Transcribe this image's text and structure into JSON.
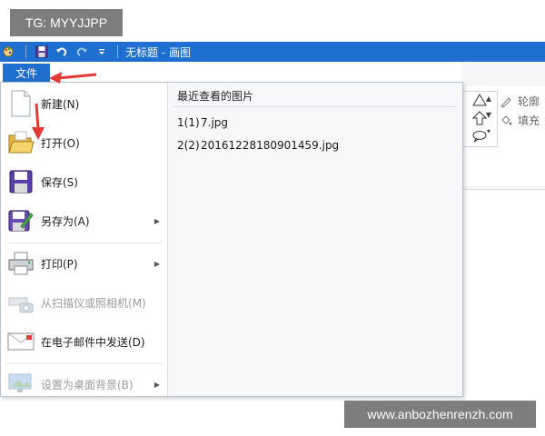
{
  "badge_text": "TG: MYYJJPP",
  "titlebar": {
    "title": "无标题 - 画图",
    "quick_access": [
      "paint-app-icon",
      "save-icon",
      "undo-icon",
      "redo-icon",
      "customize-dropdown-icon"
    ],
    "color": "#1f6fd0"
  },
  "file_tab": {
    "label": "文件"
  },
  "menu": {
    "items": [
      {
        "label": "新建(N)",
        "icon": "new-document-icon",
        "enabled": true,
        "submenu": false
      },
      {
        "label": "打开(O)",
        "icon": "open-folder-icon",
        "enabled": true,
        "submenu": false
      },
      {
        "label": "保存(S)",
        "icon": "save-disk-icon",
        "enabled": true,
        "submenu": false
      },
      {
        "label": "另存为(A)",
        "icon": "save-as-icon",
        "enabled": true,
        "submenu": true
      },
      {
        "label": "打印(P)",
        "icon": "printer-icon",
        "enabled": true,
        "submenu": true
      },
      {
        "label": "从扫描仪或照相机(M)",
        "icon": "scanner-camera-icon",
        "enabled": false,
        "submenu": false
      },
      {
        "label": "在电子邮件中发送(D)",
        "icon": "email-icon",
        "enabled": true,
        "submenu": false
      },
      {
        "label": "设置为桌面背景(B)",
        "icon": "desktop-background-icon",
        "enabled": false,
        "submenu": true
      }
    ]
  },
  "recent": {
    "title": "最近查看的图片",
    "items": [
      {
        "num": "1(1)",
        "name": "7.jpg"
      },
      {
        "num": "2(2)",
        "name": "20161228180901459.jpg"
      }
    ]
  },
  "ribbon": {
    "outline_label": "轮廓",
    "fill_label": "填充",
    "shapes": [
      "triangle-shape-icon",
      "arrow-up-shape-icon",
      "callout-shape-icon"
    ]
  },
  "watermark_text": "www.anbozhenrenzh.com",
  "annotation_color": "#e53935"
}
